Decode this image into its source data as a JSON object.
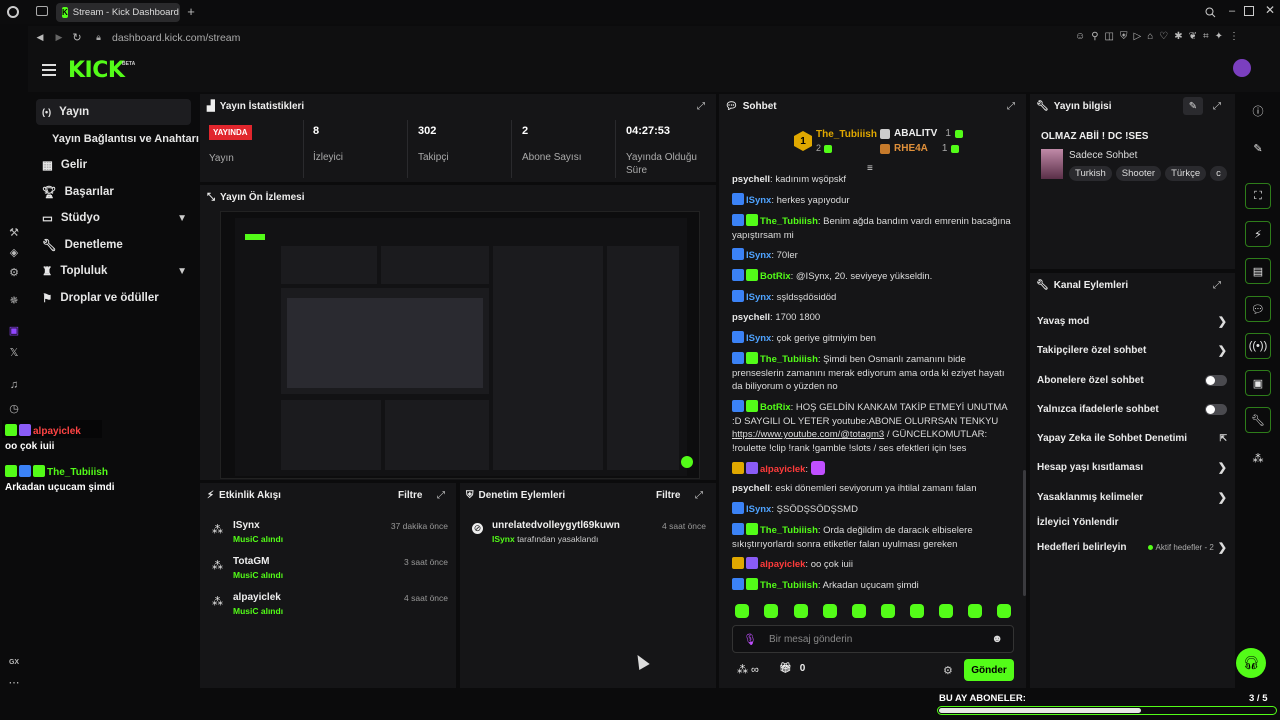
{
  "browser": {
    "tab_title": "Stream - Kick Dashboard",
    "url": "dashboard.kick.com/stream"
  },
  "header": {
    "logo": "KICK",
    "logo_badge": "BETA"
  },
  "nav": {
    "items": [
      {
        "label": "Yayın"
      },
      {
        "label": "Yayın Bağlantısı ve Anahtarı"
      },
      {
        "label": "Gelir"
      },
      {
        "label": "Başarılar"
      },
      {
        "label": "Stüdyo"
      },
      {
        "label": "Denetleme"
      },
      {
        "label": "Topluluk"
      },
      {
        "label": "Droplar ve ödüller"
      }
    ]
  },
  "stats": {
    "title": "Yayın İstatistikleri",
    "live_badge": "YAYINDA",
    "live_label": "Yayın",
    "viewers": {
      "value": "8",
      "label": "İzleyici"
    },
    "followers": {
      "value": "302",
      "label": "Takipçi"
    },
    "subs": {
      "value": "2",
      "label": "Abone Sayısı"
    },
    "uptime": {
      "value": "04:27:53",
      "label": "Yayında Olduğu Süre"
    }
  },
  "preview": {
    "title": "Yayın Ön İzlemesi"
  },
  "activity": {
    "title": "Etkinlik Akışı",
    "filter": "Filtre",
    "items": [
      {
        "name": "ISynx",
        "action": "MusiC alındı",
        "time": "37 dakika önce"
      },
      {
        "name": "TotaGM",
        "action": "MusiC alındı",
        "time": "3 saat önce"
      },
      {
        "name": "alpayiclek",
        "action": "MusiC alındı",
        "time": "4 saat önce"
      }
    ]
  },
  "moderation": {
    "title": "Denetim Eylemleri",
    "filter": "Filtre",
    "item": {
      "name": "unrelatedvolleygytl69kuwn",
      "by": "ISynx",
      "action": "tarafından yasaklandı",
      "time": "4 saat önce"
    }
  },
  "chat": {
    "title": "Sohbet",
    "top_user": "The_Tubiiish",
    "top_count": "2",
    "gifters": [
      {
        "name": "ABALITV",
        "count": "1"
      },
      {
        "name": "RHE4A",
        "count": "1"
      }
    ],
    "messages": [
      {
        "user": "psychell",
        "text": "kadınım wşöpskf"
      },
      {
        "user": "ISynx",
        "text": "herkes yapıyodur"
      },
      {
        "user": "The_Tubiiish",
        "text": "Benim ağda bandım vardı emrenin bacağına yapıştırsam mi"
      },
      {
        "user": "ISynx",
        "text": "70ler"
      },
      {
        "user": "BotRix",
        "text": "@ISynx, 20. seviyeye yükseldin."
      },
      {
        "user": "ISynx",
        "text": "sşldsşdösidöd"
      },
      {
        "user": "psychell",
        "text": "1700 1800"
      },
      {
        "user": "ISynx",
        "text": "çok geriye gitmiyim ben"
      },
      {
        "user": "The_Tubiiish",
        "text": "Şimdi ben Osmanlı zamanını bide prenseslerin zamanını merak ediyorum ama orda ki eziyet hayatı da biliyorum o yüzden no"
      },
      {
        "user": "BotRix",
        "text_pre": "HOŞ GELDİN KANKAM TAKİP ETMEYİ UNUTMA :D SAYGILI OL YETER youtube:ABONE OLURRSAN TENKYU ",
        "link": "https://www.youtube.com/@totagm3",
        "text_post": " / GÜNCELKOMUTLAR: !roulette !clip !rank !gamble !slots / ses efektleri için !ses"
      },
      {
        "user": "alpayiclek",
        "text": ""
      },
      {
        "user": "psychell",
        "text": "eski dönemleri seviyorum ya ihtilal zamanı falan"
      },
      {
        "user": "ISynx",
        "text": "ŞSÖDŞSÖDŞSMD"
      },
      {
        "user": "The_Tubiiish",
        "text": "Orda değildim de daracık elbiselere sıkıştırıyorlardı sonra etiketler falan uyulması gereken"
      },
      {
        "user": "alpayiclek",
        "text": "oo çok iuii"
      },
      {
        "user": "The_Tubiiish",
        "text": "Arkadan uçucam şimdi"
      }
    ],
    "input_placeholder": "Bir mesaj gönderin",
    "points": "∞",
    "gift_count": "0",
    "send": "Gönder"
  },
  "stream_info": {
    "title": "Yayın bilgisi",
    "stream_title": "OLMAZ ABİİ ! DC !SES",
    "category": "Sadece Sohbet",
    "tags": [
      "Turkish",
      "Shooter",
      "Türkçe",
      "c"
    ]
  },
  "channel_actions": {
    "title": "Kanal Eylemleri",
    "items": [
      {
        "label": "Yavaş mod",
        "control": "chevron"
      },
      {
        "label": "Takipçilere özel sohbet",
        "control": "chevron"
      },
      {
        "label": "Abonelere özel sohbet",
        "control": "toggle"
      },
      {
        "label": "Yalnızca ifadelerle sohbet",
        "control": "toggle"
      },
      {
        "label": "Yapay Zeka ile Sohbet Denetimi",
        "control": "external"
      },
      {
        "label": "Hesap yaşı kısıtlaması",
        "control": "chevron"
      },
      {
        "label": "Yasaklanmış kelimeler",
        "control": "chevron"
      },
      {
        "label": "İzleyici Yönlendir",
        "control": "none"
      },
      {
        "label": "Hedefleri belirleyin",
        "control": "chevron",
        "status": "Aktif hedefler - 2"
      }
    ]
  },
  "sub_goal": {
    "label": "BU AY ABONELER:",
    "current": 3,
    "target": 5,
    "text": "3 / 5"
  },
  "overlay": {
    "lines": [
      {
        "user": "alpayiclek",
        "text": "oo çok iuii"
      },
      {
        "user": "The_Tubiiish",
        "text": "Arkadan uçucam şimdi"
      }
    ]
  },
  "browser_bottom": {
    "gx": "GX"
  },
  "colors": {
    "accent": "#53fc18",
    "live": "#e1262d",
    "panel": "#151517"
  }
}
